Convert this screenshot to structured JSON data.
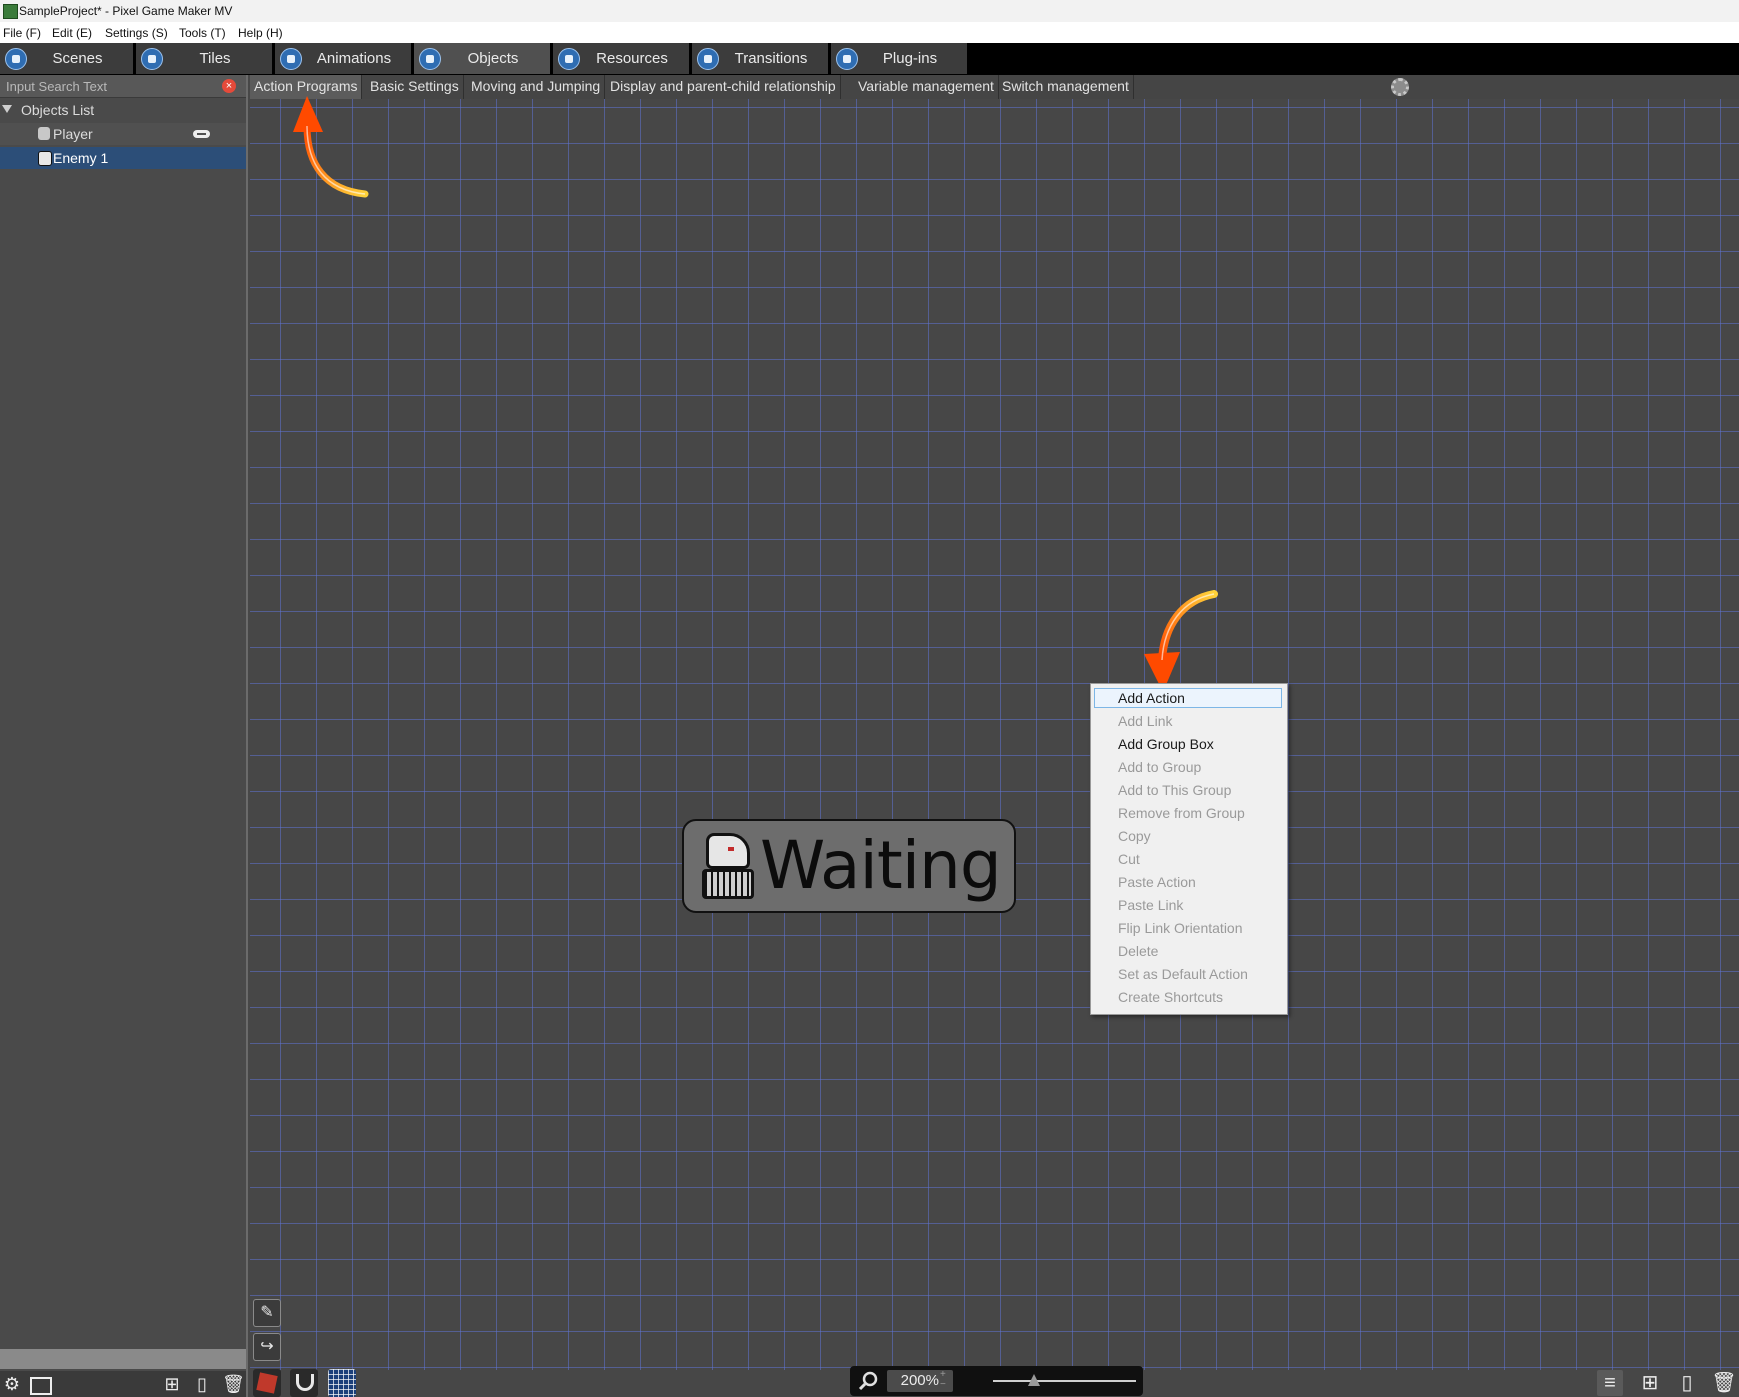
{
  "window": {
    "title": "SampleProject* - Pixel Game Maker MV"
  },
  "menubar": {
    "items": [
      "File (F)",
      "Edit (E)",
      "Settings (S)",
      "Tools (T)",
      "Help (H)"
    ]
  },
  "main_tabs": [
    {
      "label": "Scenes",
      "icon": "scenes-icon"
    },
    {
      "label": "Tiles",
      "icon": "tiles-icon"
    },
    {
      "label": "Animations",
      "icon": "animations-icon"
    },
    {
      "label": "Objects",
      "icon": "objects-icon",
      "active": true
    },
    {
      "label": "Resources",
      "icon": "resources-icon"
    },
    {
      "label": "Transitions",
      "icon": "transitions-icon"
    },
    {
      "label": "Plug-ins",
      "icon": "plugins-icon"
    }
  ],
  "sidebar": {
    "search_placeholder": "Input Search Text",
    "tree_root": "Objects List",
    "objects": [
      {
        "label": "Player",
        "icon": "player-icon",
        "badge_icon": "gamepad-icon"
      },
      {
        "label": "Enemy 1",
        "icon": "enemy-icon",
        "selected": true
      }
    ]
  },
  "sub_tabs": [
    {
      "label": "Action Programs",
      "active": true
    },
    {
      "label": "Basic Settings"
    },
    {
      "label": "Moving and Jumping"
    },
    {
      "label": "Display and parent-child relationship"
    },
    {
      "label": "Variable management"
    },
    {
      "label": "Switch management"
    }
  ],
  "canvas": {
    "action_node": {
      "label": "Waiting",
      "icon": "enemy-sprite-icon"
    }
  },
  "context_menu": {
    "items": [
      {
        "label": "Add Action",
        "enabled": true,
        "highlighted": true
      },
      {
        "label": "Add Link",
        "enabled": false
      },
      {
        "label": "Add Group Box",
        "enabled": true
      },
      {
        "label": "Add to Group",
        "enabled": false
      },
      {
        "label": "Add to This Group",
        "enabled": false
      },
      {
        "label": "Remove from Group",
        "enabled": false
      },
      {
        "label": "Copy",
        "enabled": false
      },
      {
        "label": "Cut",
        "enabled": false
      },
      {
        "label": "Paste Action",
        "enabled": false
      },
      {
        "label": "Paste Link",
        "enabled": false
      },
      {
        "label": "Flip Link Orientation",
        "enabled": false
      },
      {
        "label": "Delete",
        "enabled": false
      },
      {
        "label": "Set as Default Action",
        "enabled": false
      },
      {
        "label": "Create Shortcuts",
        "enabled": false
      }
    ]
  },
  "bottom": {
    "zoom_value": "200%"
  },
  "colors": {
    "accent_selection": "#2c4e78",
    "grid_line": "#5f73d2",
    "menu_highlight_border": "#7db6e6",
    "annotation_arrow": "#ff8a00"
  }
}
